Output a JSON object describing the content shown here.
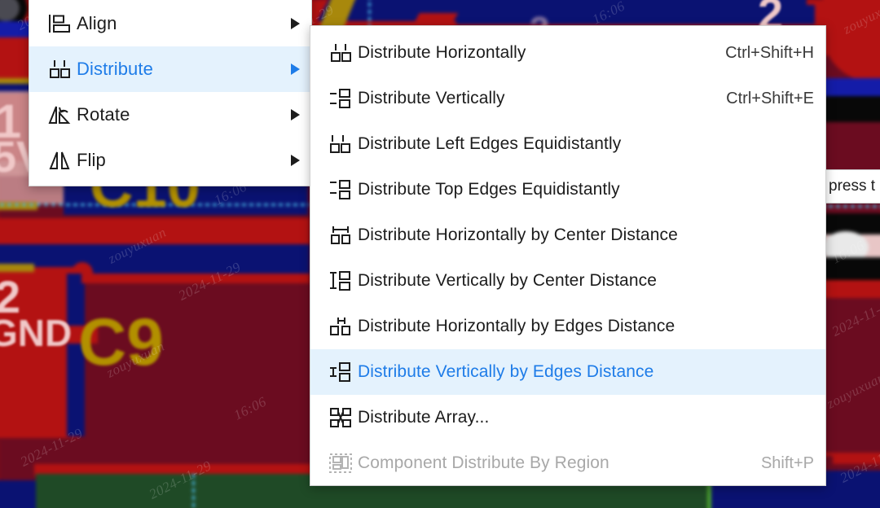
{
  "background": {
    "type": "pcb-layout-canvas",
    "silkscreen_labels": [
      "1",
      "5V",
      "2",
      "GND",
      "C10",
      "C9",
      "7",
      "2",
      "3"
    ],
    "watermarks": [
      "2024-11-29",
      "16:06",
      "zouyuxuan"
    ],
    "colors": {
      "copper_red": "#b31212",
      "dark_red": "#6b0c20",
      "plane_blue": "#0a1272",
      "bright_blue": "#141ca8",
      "trace_gold": "#a8880c",
      "solder_mask_green": "#1f4a26",
      "silk_white": "#f0c8c8"
    }
  },
  "tooltip": {
    "text": "press t"
  },
  "accent": {
    "highlight_bg": "#e4f2fd",
    "highlight_text": "#1e7ce8",
    "menu_bg": "#ffffff",
    "menu_text": "#1c1c1c",
    "disabled_text": "#a8a8a8"
  },
  "parent_menu": {
    "items": [
      {
        "icon": "align-icon",
        "label": "Align",
        "shortcut": "",
        "submenu": true,
        "selected": false,
        "disabled": false
      },
      {
        "icon": "distribute-icon",
        "label": "Distribute",
        "shortcut": "",
        "submenu": true,
        "selected": true,
        "disabled": false
      },
      {
        "icon": "rotate-icon",
        "label": "Rotate",
        "shortcut": "",
        "submenu": true,
        "selected": false,
        "disabled": false
      },
      {
        "icon": "flip-icon",
        "label": "Flip",
        "shortcut": "",
        "submenu": true,
        "selected": false,
        "disabled": false
      }
    ]
  },
  "sub_menu": {
    "items": [
      {
        "icon": "distribute-horizontally-icon",
        "label": "Distribute Horizontally",
        "shortcut": "Ctrl+Shift+H",
        "selected": false,
        "disabled": false
      },
      {
        "icon": "distribute-vertically-icon",
        "label": "Distribute Vertically",
        "shortcut": "Ctrl+Shift+E",
        "selected": false,
        "disabled": false
      },
      {
        "icon": "distribute-left-edges-icon",
        "label": "Distribute Left Edges Equidistantly",
        "shortcut": "",
        "selected": false,
        "disabled": false
      },
      {
        "icon": "distribute-top-edges-icon",
        "label": "Distribute Top Edges Equidistantly",
        "shortcut": "",
        "selected": false,
        "disabled": false
      },
      {
        "icon": "distribute-h-center-distance-icon",
        "label": "Distribute Horizontally by Center Distance",
        "shortcut": "",
        "selected": false,
        "disabled": false
      },
      {
        "icon": "distribute-v-center-distance-icon",
        "label": "Distribute Vertically by Center Distance",
        "shortcut": "",
        "selected": false,
        "disabled": false
      },
      {
        "icon": "distribute-h-edges-distance-icon",
        "label": "Distribute Horizontally by Edges Distance",
        "shortcut": "",
        "selected": false,
        "disabled": false
      },
      {
        "icon": "distribute-v-edges-distance-icon",
        "label": "Distribute Vertically by Edges Distance",
        "shortcut": "",
        "selected": true,
        "disabled": false
      },
      {
        "icon": "distribute-array-icon",
        "label": "Distribute Array...",
        "shortcut": "",
        "selected": false,
        "disabled": false
      },
      {
        "icon": "component-distribute-region-icon",
        "label": "Component Distribute By Region",
        "shortcut": "Shift+P",
        "selected": false,
        "disabled": true
      }
    ]
  }
}
